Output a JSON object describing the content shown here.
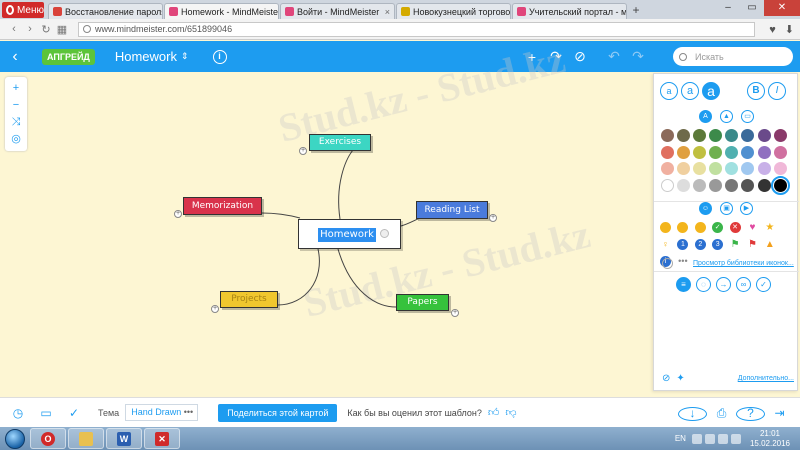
{
  "browser": {
    "menu_label": "Меню",
    "tabs": [
      {
        "label": "Восстановление пароля",
        "color": "#d9433b"
      },
      {
        "label": "Homework - MindMeister",
        "color": "#e0467b"
      },
      {
        "label": "Войти - MindMeister",
        "color": "#e0467b"
      },
      {
        "label": "Новокузнецкий торгово",
        "color": "#d4aa00"
      },
      {
        "label": "Учительский портал - ма",
        "color": "#e0467b"
      }
    ],
    "url": "www.mindmeister.com/651899046"
  },
  "header": {
    "upgrade_label": "АПГРЕЙД",
    "map_title": "Homework",
    "search_placeholder": "Искать"
  },
  "map": {
    "central": "Homework",
    "nodes": {
      "exercises": "Exercises",
      "memorization": "Memorization",
      "reading_list": "Reading List",
      "projects": "Projects",
      "papers": "Papers"
    },
    "watermark": "Stud.kz - Stud.kz"
  },
  "panel": {
    "font_sizes": [
      "a",
      "a",
      "a"
    ],
    "bold": "B",
    "italic": "I",
    "colors": [
      "#8b6a5a",
      "#6e6a4a",
      "#5c7a3a",
      "#3c8a4a",
      "#3a8a8a",
      "#3a6a9a",
      "#6a4a8a",
      "#8a3a6a",
      "#e07060",
      "#e0a040",
      "#c0c040",
      "#70b050",
      "#50b0b0",
      "#5090d0",
      "#9070c0",
      "#d070a0",
      "#f0b0a0",
      "#f0d0a0",
      "#e8e0a0",
      "#c0e0a0",
      "#a0e0e0",
      "#a0c8f0",
      "#c8b0e8",
      "#f0b8d8",
      "#ffffff",
      "#dddddd",
      "#bbbbbb",
      "#999999",
      "#777777",
      "#555555",
      "#333333",
      "#000000"
    ],
    "library_link": "Просмотр библиотеки иконок...",
    "more_link": "Дополнительно..."
  },
  "bottombar": {
    "theme_label": "Тема",
    "theme_value": "Hand Drawn",
    "theme_more": "•••",
    "share_label": "Поделиться этой картой",
    "rate_label": "Как бы вы оценил этот шаблон?"
  },
  "taskbar": {
    "lang": "EN",
    "time": "21:01",
    "date": "15.02.2016"
  }
}
